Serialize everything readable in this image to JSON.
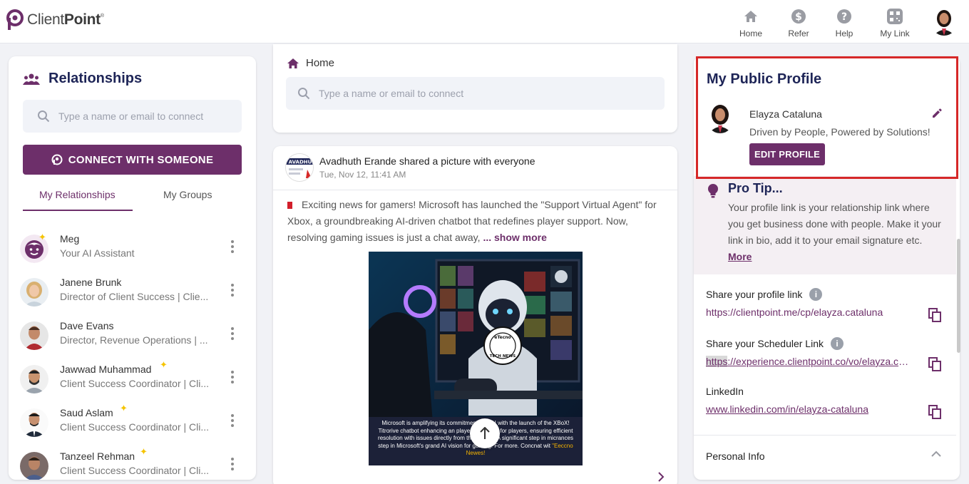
{
  "brand": {
    "name_light": "Client",
    "name_bold": "Point",
    "mark": "®"
  },
  "nav": {
    "items": [
      {
        "label": "Home",
        "icon": "home-icon"
      },
      {
        "label": "Refer",
        "icon": "dollar-icon"
      },
      {
        "label": "Help",
        "icon": "help-icon"
      },
      {
        "label": "My Link",
        "icon": "qr-icon"
      }
    ]
  },
  "left": {
    "title": "Relationships",
    "search_placeholder": "Type a name or email to connect",
    "connect_label": "CONNECT WITH SOMEONE",
    "tabs": [
      "My Relationships",
      "My Groups"
    ],
    "contacts": [
      {
        "name": "Meg",
        "role": "Your AI Assistant",
        "sparkle": true
      },
      {
        "name": "Janene Brunk",
        "role": "Director of Client Success | Clie...",
        "sparkle": false
      },
      {
        "name": "Dave Evans",
        "role": "Director, Revenue Operations | ...",
        "sparkle": false
      },
      {
        "name": "Jawwad Muhammad",
        "role": "Client Success Coordinator | Cli...",
        "sparkle": true
      },
      {
        "name": "Saud Aslam",
        "role": "Client Success Coordinator | Cli...",
        "sparkle": true
      },
      {
        "name": "Tanzeel Rehman",
        "role": "Client Success Coordinator | Cli...",
        "sparkle": true
      }
    ]
  },
  "center": {
    "home_label": "Home",
    "search_placeholder": "Type a name or email to connect",
    "post": {
      "author_line": "Avadhuth Erande shared a picture with everyone",
      "date": "Tue, Nov 12, 11:41 AM",
      "avatar_text": "AVADHU",
      "text": "Exciting news for gamers! Microsoft has launched the \"Support Virtual Agent\" for Xbox, a groundbreaking AI-driven chatbot that redefines player support. Now, resolving gaming issues is just a chat away,",
      "show_more": "... show more",
      "image_badge_top": "eTecno",
      "image_badge_bottom": "TECH NEWS",
      "image_caption": "Microsoft is amplifying its commitment with AI with the launch of the XBoX! Titrorive chatbot enhancing an playeres support for players, ensuring efficient resolution with issues directly from the console A significant step in micrances step in Microsoft's grand AI vision for gaming! For more. Concnat wit",
      "image_caption_highlight": "\"Eeccno Newes!"
    }
  },
  "right": {
    "title": "My Public Profile",
    "name": "Elayza Cataluna",
    "tagline": "Driven by People, Powered by Solutions!",
    "edit_label": "EDIT PROFILE",
    "protip": {
      "title": "Pro Tip...",
      "text": "Your profile link is your relationship link where you get business done with people. Make it your link in bio, add it to your email signature etc.",
      "more": "More"
    },
    "share_profile_label": "Share your profile link",
    "share_profile_url": "https://clientpoint.me/cp/elayza.cataluna",
    "share_scheduler_label": "Share your Scheduler Link",
    "share_scheduler_url_hl": "https",
    "share_scheduler_url_rest": "://experience.clientpoint.co/vo/elayza.cataluna",
    "linkedin_label": "LinkedIn",
    "linkedin_url": "www.linkedin.com/in/elayza-cataluna",
    "personal_info_label": "Personal Info"
  },
  "colors": {
    "brand": "#6d2f6a",
    "title": "#1e2557",
    "highlight_border": "#d62828"
  }
}
